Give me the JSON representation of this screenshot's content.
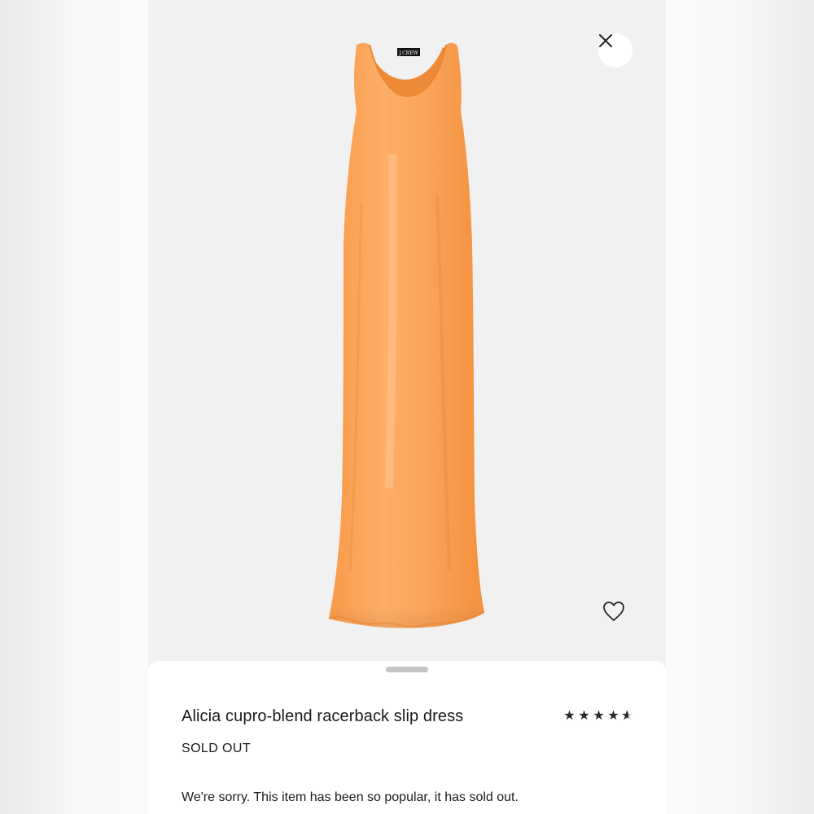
{
  "product": {
    "brand_tag": "J.CREW",
    "title": "Alicia cupro-blend racerback slip dress",
    "status": "SOLD OUT",
    "message": "We're sorry. This item has been so popular, it has sold out.",
    "rating": 4.5,
    "rating_max": 5,
    "image_icon": "orange-slip-dress-image",
    "dress_color": "#fba55c"
  },
  "controls": {
    "close_icon": "close-icon",
    "wishlist_icon": "heart-icon",
    "grabber": "sheet-grabber"
  }
}
